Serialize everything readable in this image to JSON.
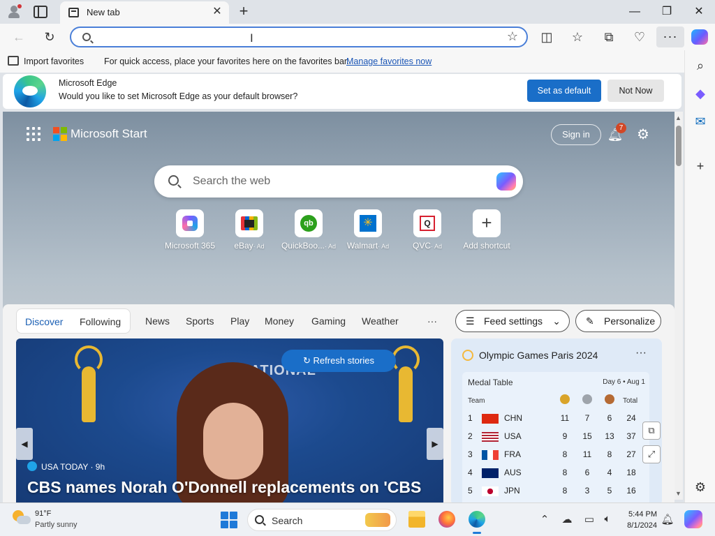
{
  "browser": {
    "tab_title": "New tab",
    "address_placeholder": "",
    "window_controls": {
      "minimize": "—",
      "restore": "❐",
      "close": "✕"
    }
  },
  "favorites_bar": {
    "import_label": "Import favorites",
    "message": "For quick access, place your favorites here on the favorites bar.",
    "manage_link": "Manage favorites now"
  },
  "infobar": {
    "title": "Microsoft Edge",
    "message": "Would you like to set Microsoft Edge as your default browser?",
    "primary_button": "Set as default",
    "secondary_button": "Not Now"
  },
  "ntp": {
    "brand": "Microsoft Start",
    "sign_in": "Sign in",
    "notification_count": "7",
    "search_placeholder": "Search the web",
    "shortcuts": [
      {
        "label": "Microsoft 365",
        "ad": ""
      },
      {
        "label": "eBay",
        "ad": "· Ad"
      },
      {
        "label": "QuickBoo...",
        "ad": "· Ad"
      },
      {
        "label": "Walmart",
        "ad": "· Ad"
      },
      {
        "label": "QVC",
        "ad": "· Ad"
      },
      {
        "label": "Add shortcut",
        "ad": ""
      }
    ]
  },
  "feed": {
    "primary_tabs": [
      "Discover",
      "Following"
    ],
    "nav": [
      "News",
      "Sports",
      "Play",
      "Money",
      "Gaming",
      "Weather"
    ],
    "more": "···",
    "feed_settings": "Feed settings",
    "personalize": "Personalize",
    "refresh": "Refresh stories",
    "hero": {
      "source": "USA TODAY · 9h",
      "headline": "CBS names Norah O'Donnell replacements on 'CBS",
      "background_text": "NATIONAL\nAMY"
    }
  },
  "olympics": {
    "title": "Olympic Games Paris 2024",
    "subtitle": "Medal Table",
    "date": "Day 6 • Aug 1",
    "col_team": "Team",
    "col_total": "Total",
    "rows": [
      {
        "rank": "1",
        "country": "CHN",
        "gold": "11",
        "silver": "7",
        "bronze": "6",
        "total": "24"
      },
      {
        "rank": "2",
        "country": "USA",
        "gold": "9",
        "silver": "15",
        "bronze": "13",
        "total": "37"
      },
      {
        "rank": "3",
        "country": "FRA",
        "gold": "8",
        "silver": "11",
        "bronze": "8",
        "total": "27"
      },
      {
        "rank": "4",
        "country": "AUS",
        "gold": "8",
        "silver": "6",
        "bronze": "4",
        "total": "18"
      },
      {
        "rank": "5",
        "country": "JPN",
        "gold": "8",
        "silver": "3",
        "bronze": "5",
        "total": "16"
      }
    ]
  },
  "taskbar": {
    "temperature": "91°F",
    "condition": "Partly sunny",
    "search_placeholder": "Search",
    "time": "5:44 PM",
    "date": "8/1/2024"
  },
  "colors": {
    "accent": "#1a6ec8",
    "link": "#1a55b5",
    "notification_badge": "#d24726"
  }
}
